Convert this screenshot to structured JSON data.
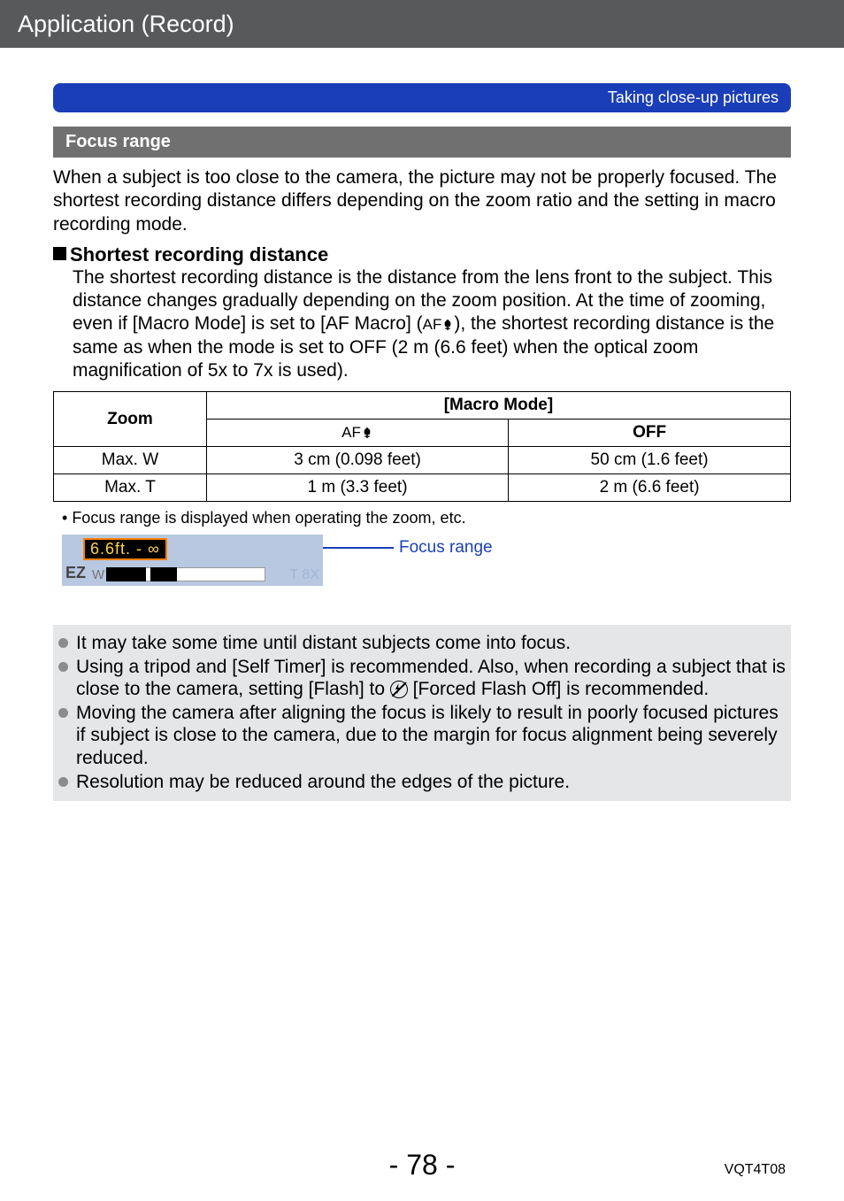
{
  "header": {
    "section_title": "Application (Record)"
  },
  "banner": {
    "text": "Taking close-up pictures"
  },
  "section_heading": "Focus range",
  "intro_paragraph": "When a subject is too close to the camera, the picture may not be properly focused. The shortest recording distance differs depending on the zoom ratio and the setting in macro recording mode.",
  "subsection": {
    "title": "Shortest recording distance",
    "text_before_icon": "The shortest recording distance is the distance from the lens front to the subject. This distance changes gradually depending on the zoom position. At the time of zooming, even if [Macro Mode] is set to [AF Macro] (",
    "text_after_icon": "), the shortest recording distance is the same as when the mode is set to OFF (2 m (6.6 feet) when the optical zoom magnification of 5x to 7x is used)."
  },
  "table": {
    "zoom_header": "Zoom",
    "macro_header": "[Macro Mode]",
    "af_macro_label": "AF",
    "off_label": "OFF",
    "rows": [
      {
        "zoom": "Max. W",
        "af_macro": "3 cm (0.098 feet)",
        "off": "50 cm (1.6 feet)"
      },
      {
        "zoom": "Max. T",
        "af_macro": "1 m (3.3 feet)",
        "off": "2 m (6.6 feet)"
      }
    ]
  },
  "bullet_note": "Focus range is displayed when operating the zoom, etc.",
  "focus_graphic": {
    "range_text": "6.6ft. - ∞",
    "ez_label": "EZ",
    "w_label": "W",
    "t_label": "T 8X",
    "caption": "Focus range"
  },
  "notes": [
    "It may take some time until distant subjects come into focus.",
    {
      "pre": "Using a tripod and [Self Timer] is recommended. Also, when recording a subject that is close to the camera, setting [Flash] to ",
      "post": " [Forced Flash Off] is recommended."
    },
    "Moving the camera after aligning the focus is likely to result in poorly focused pictures if subject is close to the camera, due to the margin for focus alignment being severely reduced.",
    "Resolution may be reduced around the edges of the picture."
  ],
  "footer": {
    "page_number": "- 78 -",
    "doc_code": "VQT4T08"
  }
}
